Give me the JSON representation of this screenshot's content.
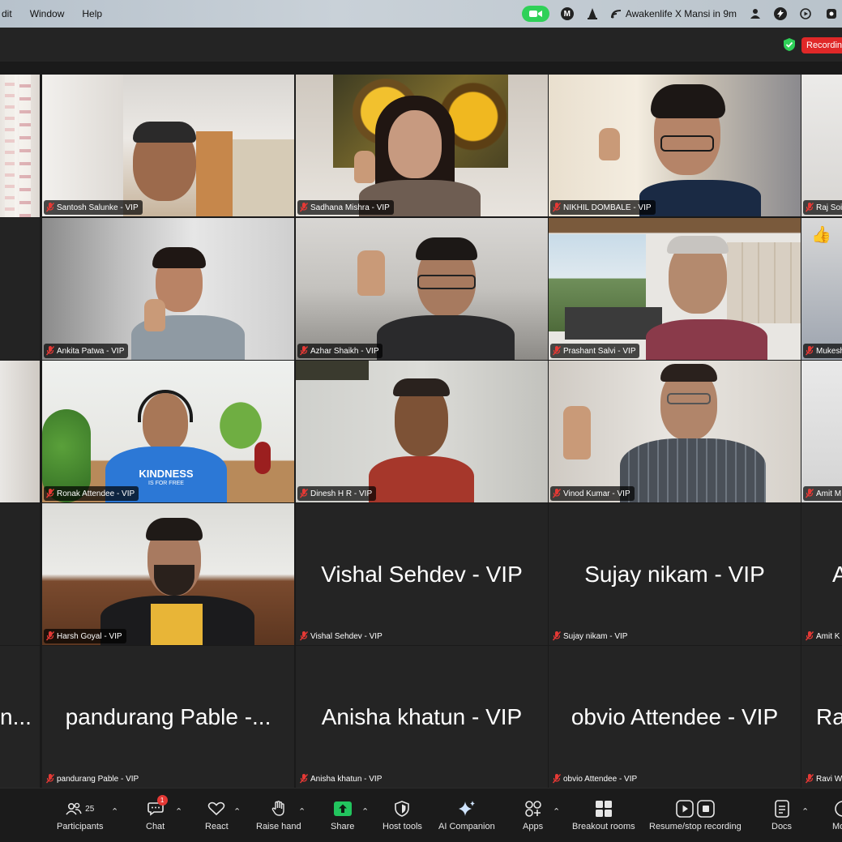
{
  "menubar": {
    "items": [
      "dit",
      "Window",
      "Help"
    ],
    "event": "Awakenlife X Mansi in 9m",
    "m_letter": "M"
  },
  "topbar": {
    "recording_label": "Recording"
  },
  "tiles": {
    "santosh": "Santosh Salunke - VIP",
    "sadhana": "Sadhana Mishra - VIP",
    "nikhil": "NIKHIL DOMBALE - VIP",
    "raj": "Raj Soi",
    "ankita": "Ankita Patwa - VIP",
    "azhar": "Azhar Shaikh - VIP",
    "prashant": "Prashant Salvi - VIP",
    "mukesh": "Mukesh",
    "ronak": "Ronak Attendee - VIP",
    "dinesh": "Dinesh H R - VIP",
    "vinod": "Vinod Kumar - VIP",
    "amit_m": "Amit M",
    "harsh": "Harsh Goyal - VIP",
    "vishal": "Vishal Sehdev - VIP",
    "sujay": "Sujay nikam - VIP",
    "amit_k": "Amit K",
    "amit_k_big": "A",
    "left_cut_big": "n...",
    "pandurang": "pandurang Pable - VIP",
    "pandurang_big": "pandurang Pable -...",
    "anisha": "Anisha khatun - VIP",
    "obvio": "obvio Attendee - VIP",
    "ravi": "Ravi W",
    "ravi_big": "Ra",
    "ronak_shirt": "KINDNESS",
    "ronak_shirt_sub": "IS FOR FREE"
  },
  "toolbar": {
    "participants_label": "Participants",
    "participants_count": "25",
    "chat_label": "Chat",
    "chat_badge": "1",
    "react_label": "React",
    "raise_hand_label": "Raise hand",
    "share_label": "Share",
    "host_tools_label": "Host tools",
    "ai_companion_label": "AI Companion",
    "apps_label": "Apps",
    "breakout_label": "Breakout rooms",
    "recording_label": "Resume/stop recording",
    "docs_label": "Docs",
    "more_label": "Mo"
  },
  "colors": {
    "accent_green": "#2fd158",
    "record_red": "#e02828",
    "share_green": "#22c55e",
    "speaker_outline": "#3ddc5c"
  }
}
